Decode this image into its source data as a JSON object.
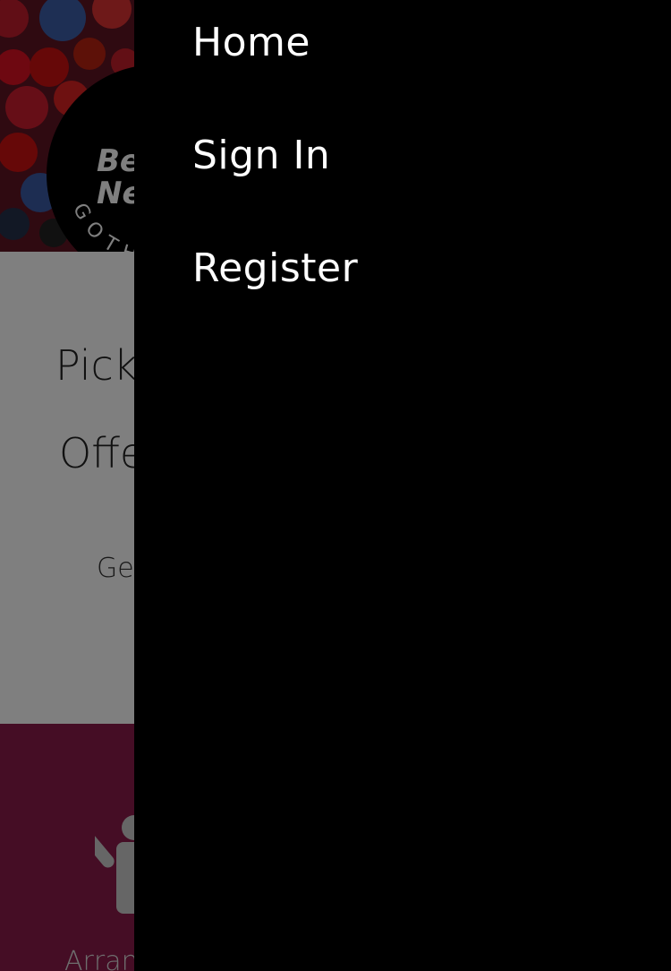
{
  "page": {
    "logo": {
      "text_line1": "Be",
      "text_line2": "Ne",
      "ring_text": "GOTHEN"
    },
    "content": {
      "line1": "Pick",
      "line2": "Offe",
      "line3": "Ge"
    },
    "features": {
      "label": "Arran"
    }
  },
  "drawer": {
    "items": [
      {
        "label": "Home"
      },
      {
        "label": "Sign In"
      },
      {
        "label": "Register"
      }
    ]
  },
  "colors": {
    "drawer_bg": "#000000",
    "features_bg": "#8a1a4a",
    "nav_text": "#ffffff"
  }
}
